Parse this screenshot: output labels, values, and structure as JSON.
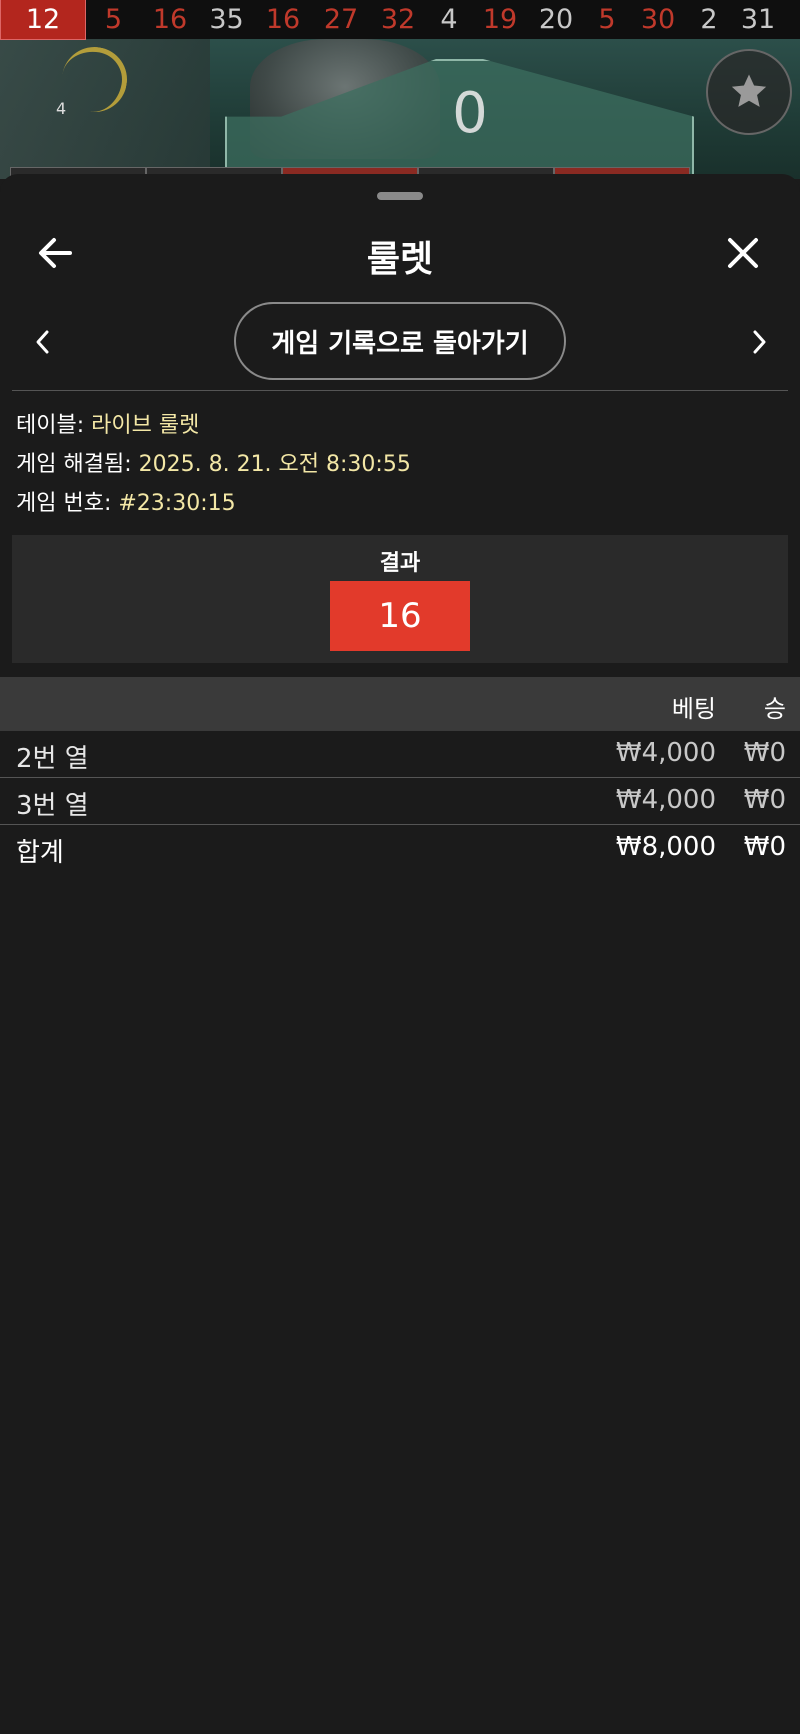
{
  "history": {
    "numbers": [
      {
        "n": "12",
        "c": "red"
      },
      {
        "n": "5",
        "c": "red"
      },
      {
        "n": "16",
        "c": "red"
      },
      {
        "n": "35",
        "c": "black"
      },
      {
        "n": "16",
        "c": "red"
      },
      {
        "n": "27",
        "c": "red"
      },
      {
        "n": "32",
        "c": "red"
      },
      {
        "n": "4",
        "c": "black"
      },
      {
        "n": "19",
        "c": "red"
      },
      {
        "n": "20",
        "c": "black"
      },
      {
        "n": "5",
        "c": "red"
      },
      {
        "n": "30",
        "c": "red"
      },
      {
        "n": "2",
        "c": "black"
      },
      {
        "n": "31",
        "c": "black"
      }
    ]
  },
  "scene": {
    "zero_label": "0",
    "dial_label": "4"
  },
  "header": {
    "title": "룰렛"
  },
  "nav": {
    "back_to_history_label": "게임 기록으로 돌아가기"
  },
  "info": {
    "table_label": "테이블:",
    "table_value": "라이브 룰렛",
    "resolved_label": "게임 해결됨:",
    "resolved_value": "2025. 8. 21. 오전 8:30:55",
    "game_no_label": "게임 번호:",
    "game_no_value": "#23:30:15"
  },
  "result": {
    "label": "결과",
    "number": "16",
    "color": "#e23a2b"
  },
  "bets_table": {
    "headers": {
      "bet": "베팅",
      "win": "승"
    },
    "rows": [
      {
        "name": "2번 열",
        "bet": "₩4,000",
        "win": "₩0"
      },
      {
        "name": "3번 열",
        "bet": "₩4,000",
        "win": "₩0"
      }
    ],
    "total": {
      "name": "합계",
      "bet": "₩8,000",
      "win": "₩0"
    }
  }
}
